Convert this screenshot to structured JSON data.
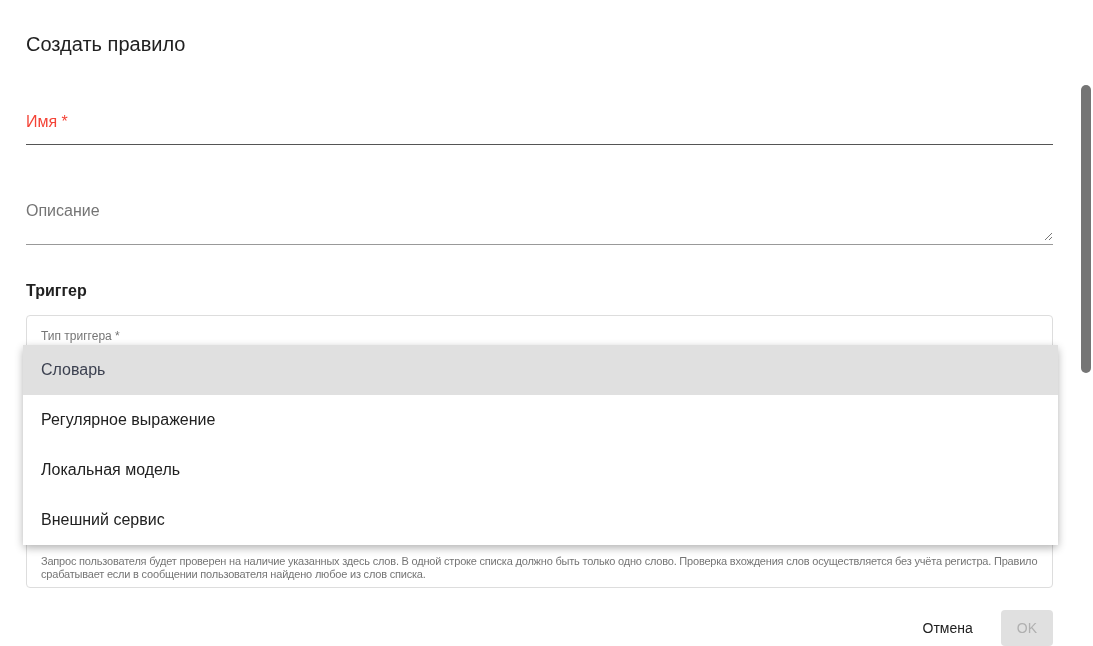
{
  "dialog": {
    "title": "Создать правило"
  },
  "name_field": {
    "label": "Имя *",
    "error": true
  },
  "description_field": {
    "label": "Описание"
  },
  "trigger_section": {
    "heading": "Триггер",
    "type_label": "Тип триггера *",
    "hint": "Запрос пользователя будет проверен на наличие указанных здесь слов. В одной строке списка должно быть только одно слово. Проверка вхождения слов осуществляется без учёта регистра. Правило срабатывает если в сообщении пользователя найдено любое из слов списка."
  },
  "menu": {
    "items": [
      {
        "label": "Словарь",
        "selected": true
      },
      {
        "label": "Регулярное выражение",
        "selected": false
      },
      {
        "label": "Локальная модель",
        "selected": false
      },
      {
        "label": "Внешний сервис",
        "selected": false
      }
    ]
  },
  "buttons": [
    {
      "label": "Отмена",
      "disabled": false
    },
    {
      "label": "OK",
      "disabled": true
    }
  ]
}
